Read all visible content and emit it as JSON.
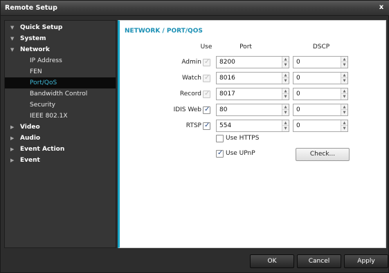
{
  "window": {
    "title": "Remote Setup",
    "close_glyph": "x"
  },
  "nav": [
    {
      "label": "Quick Setup",
      "expanded": true
    },
    {
      "label": "System",
      "expanded": true
    },
    {
      "label": "Network",
      "expanded": true
    },
    {
      "label": "IP Address",
      "sub": true
    },
    {
      "label": "FEN",
      "sub": true
    },
    {
      "label": "Port/QoS",
      "sub": true,
      "active": true
    },
    {
      "label": "Bandwidth Control",
      "sub": true
    },
    {
      "label": "Security",
      "sub": true
    },
    {
      "label": "IEEE 802.1X",
      "sub": true
    },
    {
      "label": "Video",
      "expanded": false
    },
    {
      "label": "Audio",
      "expanded": false
    },
    {
      "label": "Event Action",
      "expanded": false
    },
    {
      "label": "Event",
      "expanded": false
    }
  ],
  "page": {
    "title": "NETWORK / PORT/QOS",
    "columns": {
      "use": "Use",
      "port": "Port",
      "dscp": "DSCP"
    },
    "rows": [
      {
        "label": "Admin",
        "use_checked": true,
        "use_enabled": false,
        "port": "8200",
        "dscp": "0"
      },
      {
        "label": "Watch",
        "use_checked": true,
        "use_enabled": false,
        "port": "8016",
        "dscp": "0"
      },
      {
        "label": "Record",
        "use_checked": true,
        "use_enabled": false,
        "port": "8017",
        "dscp": "0"
      },
      {
        "label": "IDIS Web",
        "use_checked": true,
        "use_enabled": true,
        "port": "80",
        "dscp": "0"
      },
      {
        "label": "RTSP",
        "use_checked": true,
        "use_enabled": true,
        "port": "554",
        "dscp": "0"
      }
    ],
    "use_https": {
      "label": "Use HTTPS",
      "checked": false
    },
    "use_upnp": {
      "label": "Use UPnP",
      "checked": true
    },
    "check_button": "Check..."
  },
  "footer": {
    "ok": "OK",
    "cancel": "Cancel",
    "apply": "Apply"
  },
  "colors": {
    "accent": "#17a5c8",
    "title_blue": "#1a8fb4",
    "active_nav": "#3fb8d6"
  }
}
